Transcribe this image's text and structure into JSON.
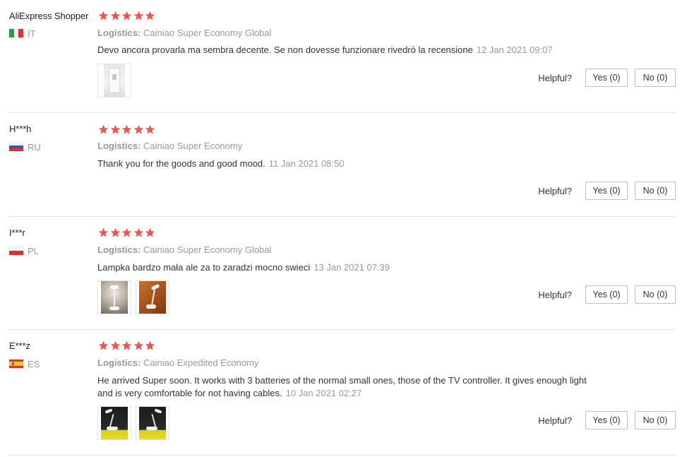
{
  "labels": {
    "logistics_prefix": "Logistics:",
    "helpful": "Helpful?"
  },
  "colors": {
    "star": "#f3534e",
    "muted": "#999999",
    "divider": "#e6e6e6"
  },
  "reviews": [
    {
      "user": "AliExpress Shopper",
      "country": "IT",
      "flag_icon": "italy-flag-icon",
      "rating": 5,
      "logistics": "Cainiao Super Economy Global",
      "text": "Devo ancora provarla ma sembra decente. Se non dovesse funzionare rivedrò la recensione",
      "date": "12 Jan 2021 09:07",
      "photos": [
        "product-photo-white-package"
      ],
      "yes": "Yes (0)",
      "no": "No (0)"
    },
    {
      "user": "H***h",
      "country": "RU",
      "flag_icon": "russia-flag-icon",
      "rating": 5,
      "logistics": "Cainiao Super Economy",
      "text": "Thank you for the goods and good mood.",
      "date": "11 Jan 2021 08:50",
      "photos": [],
      "yes": "Yes (0)",
      "no": "No (0)"
    },
    {
      "user": "I***r",
      "country": "PL",
      "flag_icon": "poland-flag-icon",
      "rating": 5,
      "logistics": "Cainiao Super Economy Global",
      "text": "Lampka bardzo mała ale za to zaradzi mocno swieci",
      "date": "13 Jan 2021 07:39",
      "photos": [
        "lamp-photo-dim",
        "lamp-photo-wood"
      ],
      "yes": "Yes (0)",
      "no": "No (0)"
    },
    {
      "user": "E***z",
      "country": "ES",
      "flag_icon": "spain-flag-icon",
      "rating": 5,
      "logistics": "Cainiao Expedited Economy",
      "text": "He arrived Super soon. It works with 3 batteries of the normal small ones, those of the TV controller. It gives enough light and is very comfortable for not having cables.",
      "date": "10 Jan 2021 02:27",
      "photos": [
        "lamp-photo-night-1",
        "lamp-photo-night-2"
      ],
      "yes": "Yes (0)",
      "no": "No (0)"
    }
  ]
}
